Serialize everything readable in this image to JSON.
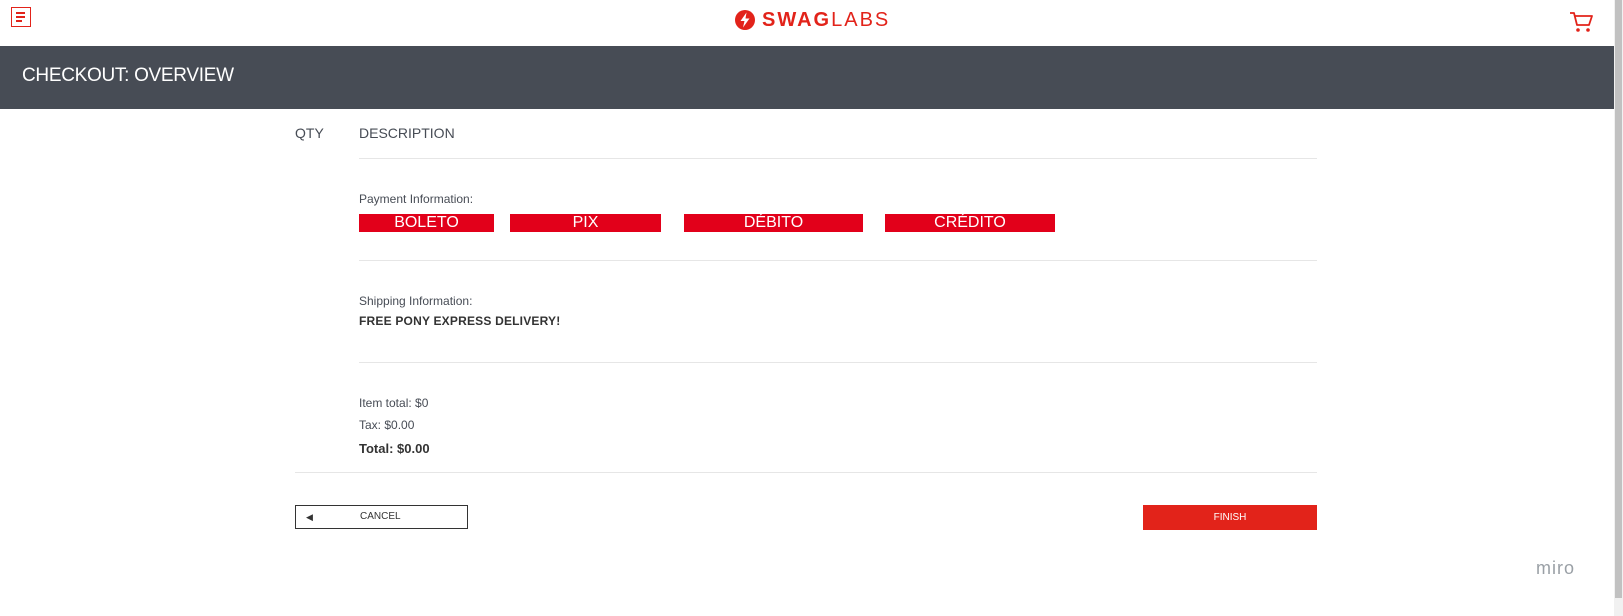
{
  "header": {
    "brand_bold": "SWAG",
    "brand_light": "LABS",
    "menu_icon": "hamburger-menu-icon",
    "cart_icon": "shopping-cart-icon"
  },
  "subheader": {
    "title": "CHECKOUT: OVERVIEW"
  },
  "cart_list": {
    "qty_label": "QTY",
    "description_label": "DESCRIPTION"
  },
  "payment": {
    "label": "Payment Information:",
    "options": [
      "BOLETO",
      "PIX",
      "DÉBITO",
      "CRÉDITO"
    ]
  },
  "shipping": {
    "label": "Shipping Information:",
    "value": "FREE PONY EXPRESS DELIVERY!"
  },
  "summary": {
    "item_total": "Item total: $0",
    "tax": "Tax: $0.00",
    "total": "Total: $0.00"
  },
  "actions": {
    "cancel_label": "CANCEL",
    "finish_label": "FINISH"
  },
  "watermark": "miro",
  "colors": {
    "accent": "#e2231a",
    "payment_button": "#e2001a",
    "subheader_bg": "#474c55"
  }
}
